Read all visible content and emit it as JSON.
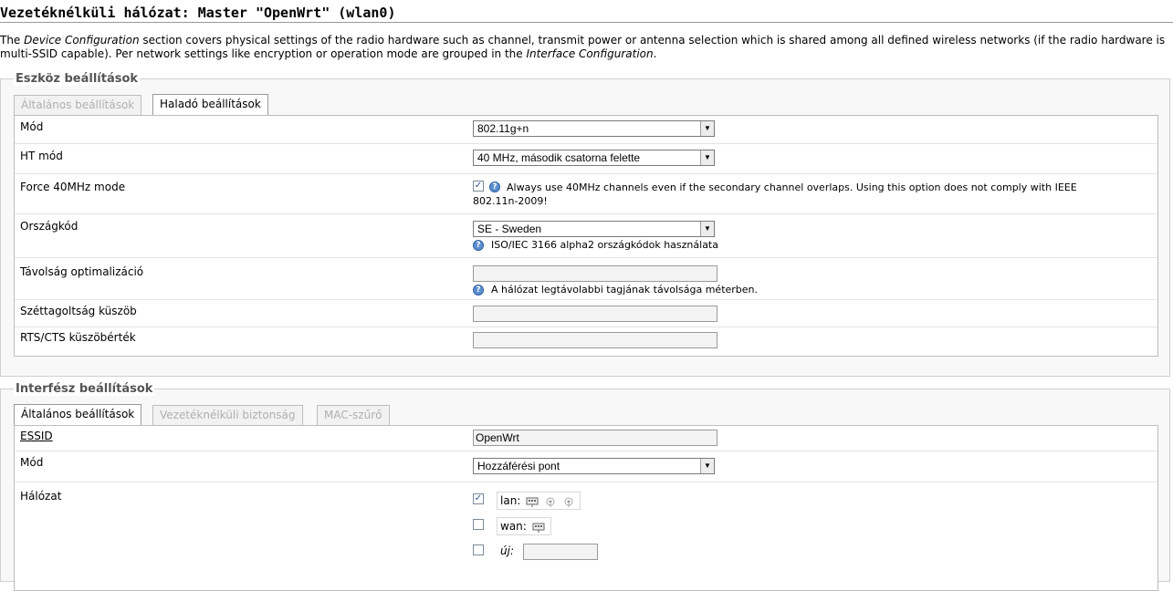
{
  "page": {
    "title": "Vezetéknélküli hálózat: Master \"OpenWrt\" (wlan0)",
    "intro_parts": [
      "The ",
      "Device Configuration",
      " section covers physical settings of the radio hardware such as channel, transmit power or antenna selection which is shared among all defined wireless networks (if the radio hardware is multi-SSID capable). Per network settings like encryption or operation mode are grouped in the ",
      "Interface Configuration",
      "."
    ]
  },
  "device": {
    "legend": "Eszköz beállítások",
    "tabs": [
      "Általános beállítások",
      "Haladó beállítások"
    ],
    "rows": {
      "mode": {
        "label": "Mód",
        "value": "802.11g+n"
      },
      "htmode": {
        "label": "HT mód",
        "value": "40 MHz, második csatorna felette"
      },
      "force40": {
        "label": "Force 40MHz mode",
        "checked": "✓",
        "desc": "Always use 40MHz channels even if the secondary channel overlaps. Using this option does not comply with IEEE 802.11n-2009!"
      },
      "country": {
        "label": "Országkód",
        "value": "SE - Sweden",
        "desc": "ISO/IEC 3166 alpha2 országkódok használata"
      },
      "distance": {
        "label": "Távolság optimalizáció",
        "value": "",
        "desc": "A hálózat legtávolabbi tagjának távolsága méterben."
      },
      "frag": {
        "label": "Széttagoltság küszöb",
        "value": ""
      },
      "rts": {
        "label": "RTS/CTS küszöbérték",
        "value": ""
      }
    }
  },
  "iface": {
    "legend": "Interfész beállítások",
    "tabs": [
      "Általános beállítások",
      "Vezetéknélküli biztonság",
      "MAC-szűrő"
    ],
    "rows": {
      "essid": {
        "label": "ESSID",
        "value": "OpenWrt"
      },
      "mode": {
        "label": "Mód",
        "value": "Hozzáférési pont"
      },
      "network": {
        "label": "Hálózat",
        "items": [
          {
            "name": "lan:",
            "checked": "✓"
          },
          {
            "name": "wan:",
            "checked": ""
          },
          {
            "name": "új:",
            "checked": ""
          }
        ]
      }
    }
  },
  "icons": {
    "help": "?",
    "arrow": "▼"
  }
}
